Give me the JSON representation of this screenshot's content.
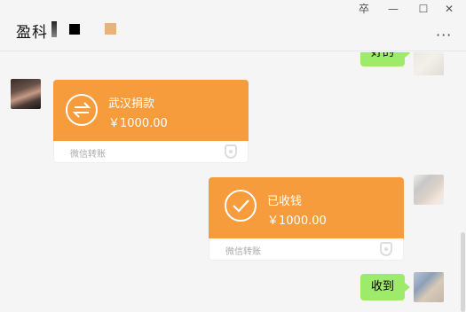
{
  "window": {
    "title": "盈科",
    "pin_glyph": "卒",
    "minimize_glyph": "—",
    "maximize_glyph": "☐",
    "close_glyph": "✕",
    "more_glyph": "···"
  },
  "messages": [
    {
      "kind": "text",
      "side": "right",
      "text": "好的"
    },
    {
      "kind": "transfer",
      "side": "left",
      "title": "武汉捐款",
      "amount": "￥1000.00",
      "footer": "微信转账",
      "icon": "transfer-arrows-icon"
    },
    {
      "kind": "transfer",
      "side": "right",
      "title": "已收钱",
      "amount": "￥1000.00",
      "footer": "微信转账",
      "icon": "check-icon"
    },
    {
      "kind": "text",
      "side": "right",
      "text": "收到"
    }
  ],
  "colors": {
    "transfer_orange": "#f79c3c",
    "bubble_green": "#9eea6a",
    "background": "#f5f5f5"
  }
}
